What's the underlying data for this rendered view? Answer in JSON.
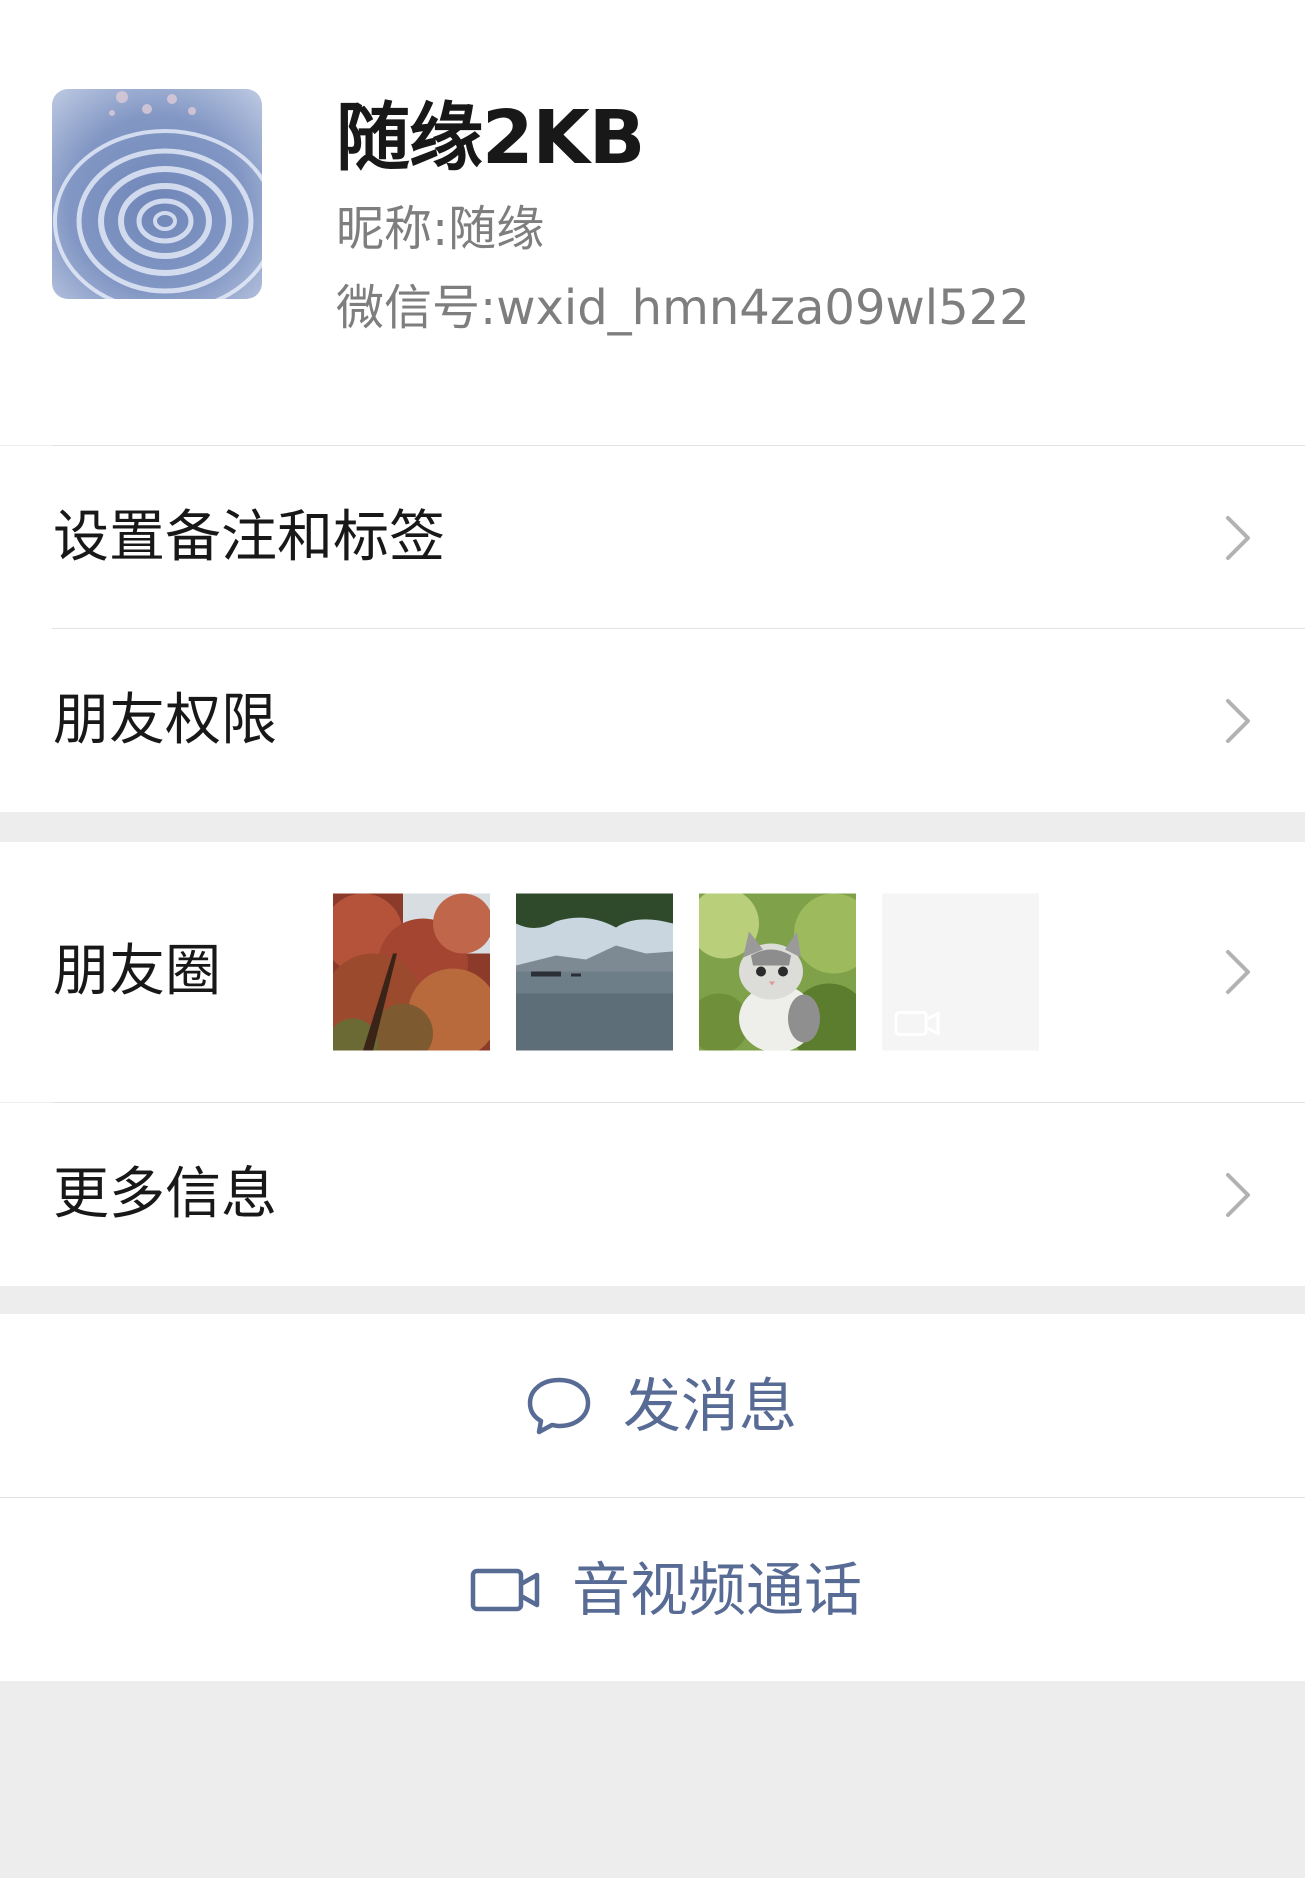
{
  "profile": {
    "display_name": "随缘2KB",
    "nickname_label": "昵称:",
    "nickname": "随缘",
    "wxid_label": "微信号:",
    "wxid": "wxid_hmn4za09wl522"
  },
  "menu": {
    "remark_tags": "设置备注和标签",
    "friend_permissions": "朋友权限",
    "moments": "朋友圈",
    "more_info": "更多信息"
  },
  "actions": {
    "send_message": "发消息",
    "av_call": "音视频通话"
  },
  "colors": {
    "accent": "#576b95",
    "background": "#ededed",
    "surface": "#ffffff",
    "secondary_text": "#7e7e7e"
  },
  "icons": {
    "chevron": "chevron-right-icon",
    "message": "chat-bubble-icon",
    "call": "video-camera-icon"
  }
}
